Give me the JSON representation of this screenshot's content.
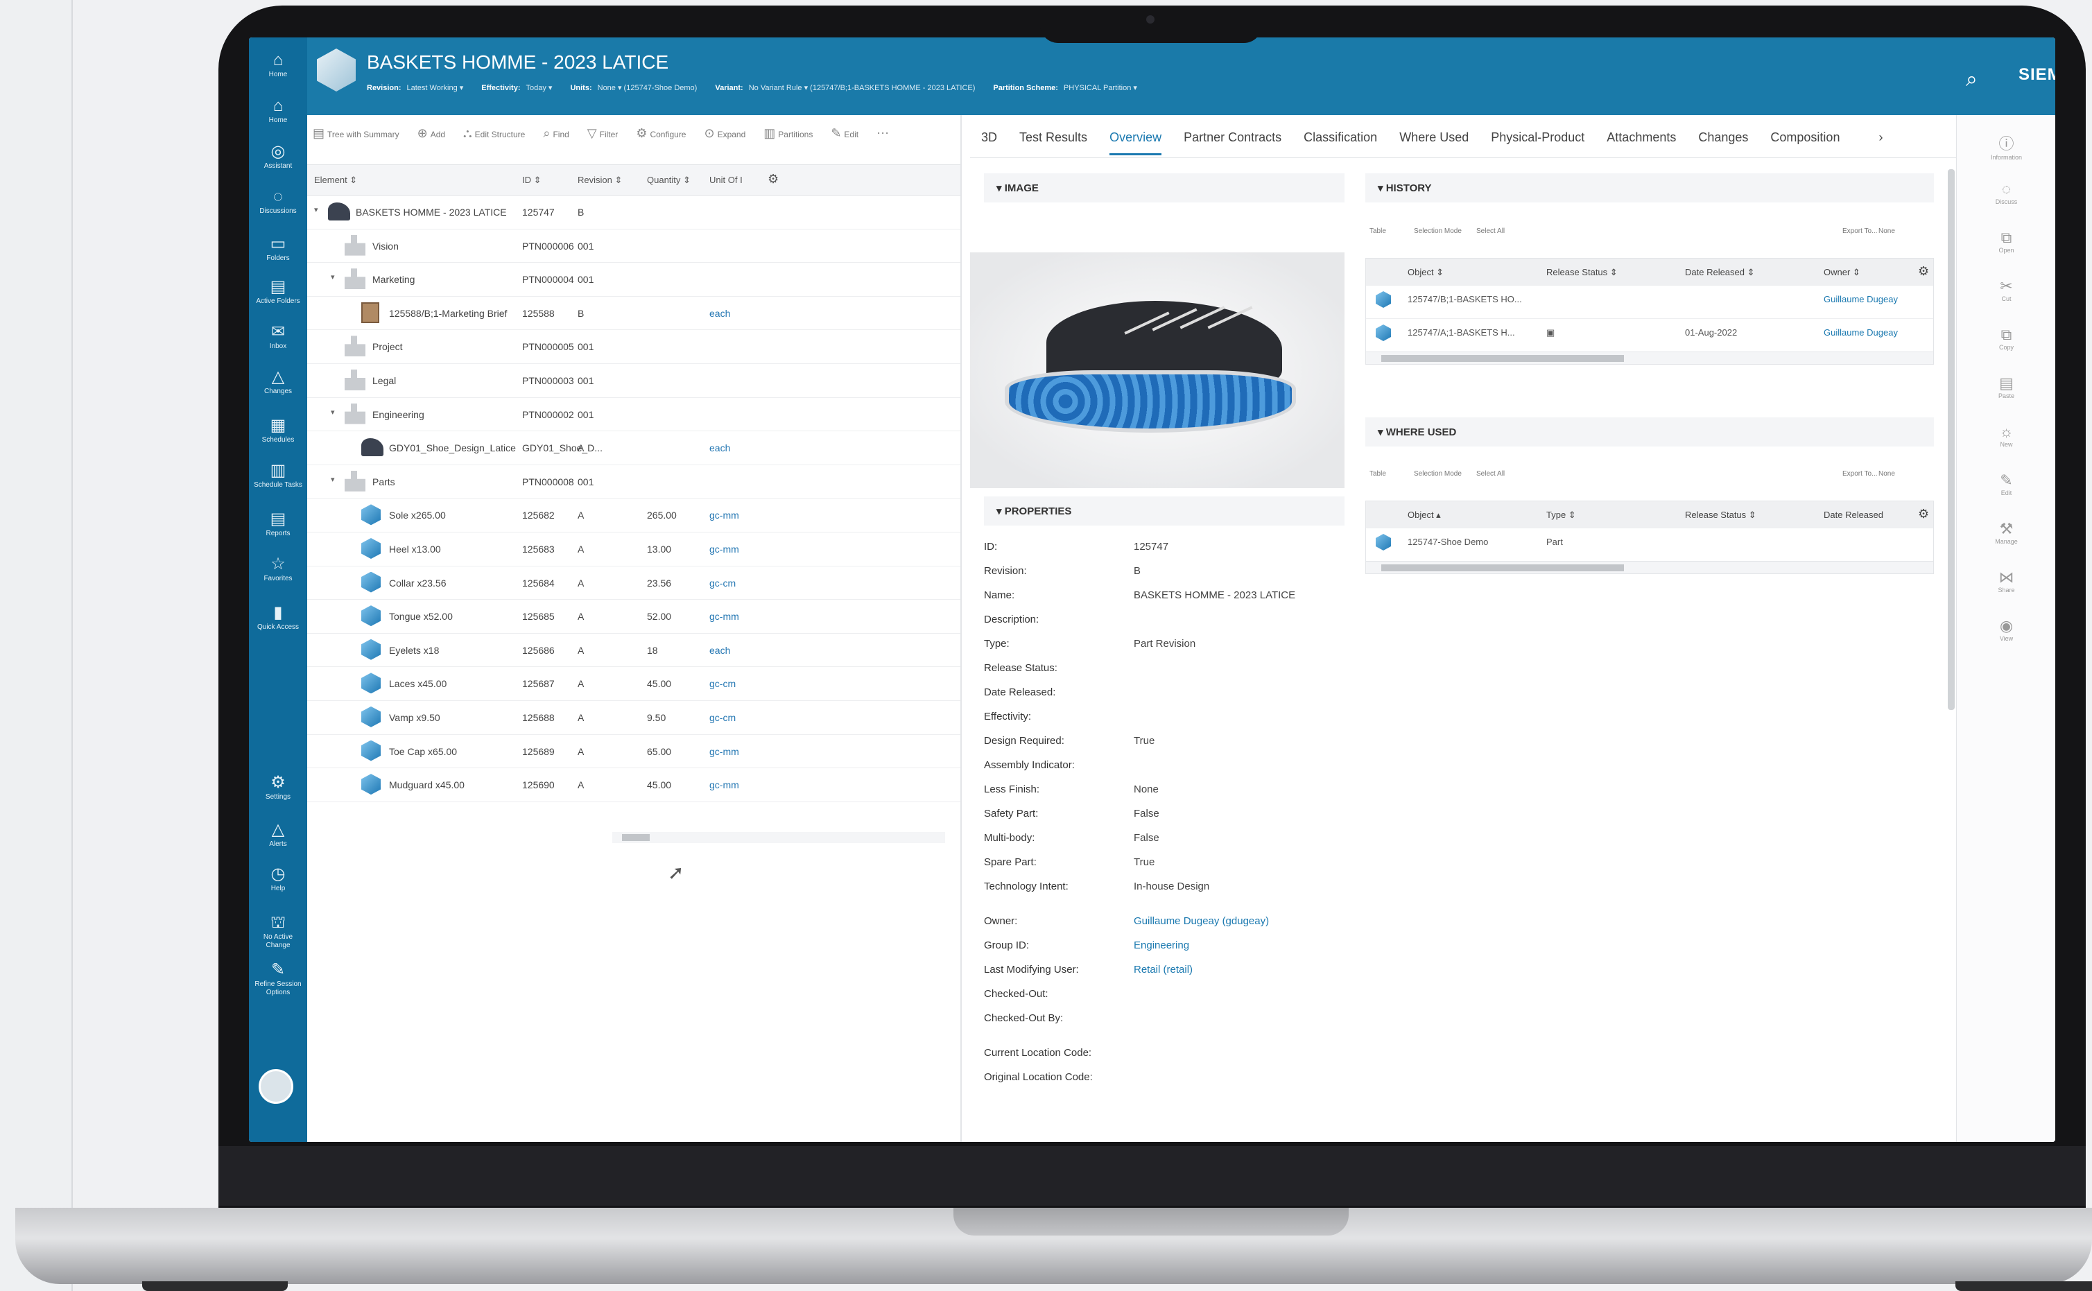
{
  "app": {
    "title": "BASKETS HOMME - 2023 LATICE",
    "brand": "SIEMENS",
    "context": [
      {
        "label": "Revision:",
        "value": "Latest Working ▾"
      },
      {
        "label": "Effectivity:",
        "value": "Today ▾"
      },
      {
        "label": "Units:",
        "value": "None ▾  (125747-Shoe Demo)"
      },
      {
        "label": "Variant:",
        "value": "No Variant Rule ▾  (125747/B;1-BASKETS HOMME - 2023 LATICE)"
      },
      {
        "label": "Partition Scheme:",
        "value": "PHYSICAL Partition ▾"
      }
    ]
  },
  "sidenav": [
    {
      "icon": "⌂",
      "label": "Home"
    },
    {
      "icon": "⌂",
      "label": "Home"
    },
    {
      "icon": "◎",
      "label": "Assistant"
    },
    {
      "icon": "◌",
      "label": "Discussions"
    },
    {
      "icon": "▭",
      "label": "Folders"
    },
    {
      "icon": "▤",
      "label": "Active Folders"
    },
    {
      "icon": "✉",
      "label": "Inbox"
    },
    {
      "icon": "△",
      "label": "Changes"
    },
    {
      "icon": "▦",
      "label": "Schedules"
    },
    {
      "icon": "▥",
      "label": "Schedule Tasks"
    },
    {
      "icon": "▤",
      "label": "Reports"
    },
    {
      "icon": "☆",
      "label": "Favorites"
    },
    {
      "icon": "▮",
      "label": "Quick Access"
    },
    {
      "icon": "⚙",
      "label": "Settings"
    },
    {
      "icon": "△",
      "label": "Alerts"
    },
    {
      "icon": "◷",
      "label": "Help"
    },
    {
      "icon": "⛫",
      "label": "No Active Change"
    },
    {
      "icon": "✎",
      "label": "Refine Session Options"
    }
  ],
  "toolbar": [
    {
      "icon": "▤",
      "label": "Tree with Summary"
    },
    {
      "icon": "⊕",
      "label": "Add"
    },
    {
      "icon": "⛬",
      "label": "Edit Structure"
    },
    {
      "icon": "⌕",
      "label": "Find"
    },
    {
      "icon": "▽",
      "label": "Filter"
    },
    {
      "icon": "⚙",
      "label": "Configure"
    },
    {
      "icon": "⊙",
      "label": "Expand"
    },
    {
      "icon": "▥",
      "label": "Partitions"
    },
    {
      "icon": "✎",
      "label": "Edit"
    },
    {
      "icon": "⋯",
      "label": ""
    }
  ],
  "tree": {
    "headers": {
      "element": "Element ⇕",
      "id": "ID ⇕",
      "revision": "Revision ⇕",
      "quantity": "Quantity ⇕",
      "unit": "Unit Of I"
    },
    "rows": [
      {
        "twisty": "▾",
        "indent": 0,
        "icon": "shoe",
        "element": "BASKETS HOMME - 2023 LATICE",
        "id": "125747",
        "revision": "B",
        "quantity": "",
        "unit": ""
      },
      {
        "twisty": "",
        "indent": 1,
        "icon": "bom",
        "element": "Vision",
        "id": "PTN000006",
        "revision": "001",
        "quantity": "",
        "unit": ""
      },
      {
        "twisty": "▾",
        "indent": 1,
        "icon": "bom",
        "element": "Marketing",
        "id": "PTN000004",
        "revision": "001",
        "quantity": "",
        "unit": ""
      },
      {
        "twisty": "",
        "indent": 2,
        "icon": "doc",
        "element": "125588/B;1-Marketing Brief",
        "id": "125588",
        "revision": "B",
        "quantity": "",
        "unit": "each"
      },
      {
        "twisty": "",
        "indent": 1,
        "icon": "bom",
        "element": "Project",
        "id": "PTN000005",
        "revision": "001",
        "quantity": "",
        "unit": ""
      },
      {
        "twisty": "",
        "indent": 1,
        "icon": "bom",
        "element": "Legal",
        "id": "PTN000003",
        "revision": "001",
        "quantity": "",
        "unit": ""
      },
      {
        "twisty": "▾",
        "indent": 1,
        "icon": "bom",
        "element": "Engineering",
        "id": "PTN000002",
        "revision": "001",
        "quantity": "",
        "unit": ""
      },
      {
        "twisty": "",
        "indent": 2,
        "icon": "shoe",
        "element": "GDY01_Shoe_Design_Latice",
        "id": "GDY01_Shoe_D...",
        "revision": "A",
        "quantity": "",
        "unit": "each"
      },
      {
        "twisty": "▾",
        "indent": 1,
        "icon": "bom",
        "element": "Parts",
        "id": "PTN000008",
        "revision": "001",
        "quantity": "",
        "unit": ""
      },
      {
        "twisty": "",
        "indent": 2,
        "icon": "cube",
        "element": "Sole x265.00",
        "id": "125682",
        "revision": "A",
        "quantity": "265.00",
        "unit": "gc-mm"
      },
      {
        "twisty": "",
        "indent": 2,
        "icon": "cube",
        "element": "Heel x13.00",
        "id": "125683",
        "revision": "A",
        "quantity": "13.00",
        "unit": "gc-mm"
      },
      {
        "twisty": "",
        "indent": 2,
        "icon": "cube",
        "element": "Collar x23.56",
        "id": "125684",
        "revision": "A",
        "quantity": "23.56",
        "unit": "gc-cm"
      },
      {
        "twisty": "",
        "indent": 2,
        "icon": "cube",
        "element": "Tongue x52.00",
        "id": "125685",
        "revision": "A",
        "quantity": "52.00",
        "unit": "gc-mm"
      },
      {
        "twisty": "",
        "indent": 2,
        "icon": "cube",
        "element": "Eyelets x18",
        "id": "125686",
        "revision": "A",
        "quantity": "18",
        "unit": "each"
      },
      {
        "twisty": "",
        "indent": 2,
        "icon": "cube",
        "element": "Laces x45.00",
        "id": "125687",
        "revision": "A",
        "quantity": "45.00",
        "unit": "gc-cm"
      },
      {
        "twisty": "",
        "indent": 2,
        "icon": "cube",
        "element": "Vamp x9.50",
        "id": "125688",
        "revision": "A",
        "quantity": "9.50",
        "unit": "gc-cm"
      },
      {
        "twisty": "",
        "indent": 2,
        "icon": "cube",
        "element": "Toe Cap x65.00",
        "id": "125689",
        "revision": "A",
        "quantity": "65.00",
        "unit": "gc-mm"
      },
      {
        "twisty": "",
        "indent": 2,
        "icon": "cube",
        "element": "Mudguard x45.00",
        "id": "125690",
        "revision": "A",
        "quantity": "45.00",
        "unit": "gc-mm"
      }
    ]
  },
  "tabs": {
    "items": [
      "3D",
      "Test Results",
      "Overview",
      "Partner Contracts",
      "Classification",
      "Where Used",
      "Physical-Product",
      "Attachments",
      "Changes",
      "Composition"
    ],
    "active": "Overview",
    "more": "›"
  },
  "image_section": {
    "title": "IMAGE"
  },
  "properties": {
    "title": "PROPERTIES",
    "items": [
      {
        "label": "ID:",
        "value": "125747",
        "link": false
      },
      {
        "label": "Revision:",
        "value": "B",
        "link": false
      },
      {
        "label": "Name:",
        "value": "BASKETS HOMME - 2023 LATICE",
        "link": false
      },
      {
        "label": "Description:",
        "value": "",
        "link": false
      },
      {
        "label": "Type:",
        "value": "Part Revision",
        "link": false
      },
      {
        "label": "Release Status:",
        "value": "",
        "link": false
      },
      {
        "label": "Date Released:",
        "value": "",
        "link": false
      },
      {
        "label": "Effectivity:",
        "value": "",
        "link": false
      },
      {
        "label": "Design Required:",
        "value": "True",
        "link": false
      },
      {
        "label": "Assembly Indicator:",
        "value": "",
        "link": false
      },
      {
        "label": "Less Finish:",
        "value": "None",
        "link": false
      },
      {
        "label": "Safety Part:",
        "value": "False",
        "link": false
      },
      {
        "label": "Multi-body:",
        "value": "False",
        "link": false
      },
      {
        "label": "Spare Part:",
        "value": "True",
        "link": false
      },
      {
        "label": "Technology Intent:",
        "value": "In-house Design",
        "link": false
      },
      {
        "label": "Owner:",
        "value": "Guillaume Dugeay (gdugeay)",
        "link": true
      },
      {
        "label": "Group ID:",
        "value": "Engineering",
        "link": true
      },
      {
        "label": "Last Modifying User:",
        "value": "Retail (retail)",
        "link": true
      },
      {
        "label": "Checked-Out:",
        "value": "",
        "link": false
      },
      {
        "label": "Checked-Out By:",
        "value": "",
        "link": false
      },
      {
        "label": "Current Location Code:",
        "value": "",
        "link": false
      },
      {
        "label": "Original Location Code:",
        "value": "",
        "link": false
      }
    ]
  },
  "history": {
    "title": "HISTORY",
    "tools": [
      "Table",
      "Selection Mode",
      "Select All",
      "Export To...",
      "None"
    ],
    "headers": [
      "Object ⇕",
      "Release Status ⇕",
      "Date Released ⇕",
      "Owner ⇕"
    ],
    "rows": [
      {
        "object": "125747/B;1-BASKETS HO...",
        "status": "",
        "date": "",
        "owner": "Guillaume Dugeay"
      },
      {
        "object": "125747/A;1-BASKETS H...",
        "status": "▣",
        "date": "01-Aug-2022",
        "owner": "Guillaume Dugeay"
      }
    ]
  },
  "where_used": {
    "title": "WHERE USED",
    "tools": [
      "Table",
      "Selection Mode",
      "Select All",
      "Export To...",
      "None"
    ],
    "headers": [
      "Object ▴",
      "Type ⇕",
      "Release Status ⇕",
      "Date Released"
    ],
    "rows": [
      {
        "object": "125747-Shoe Demo",
        "type": "Part",
        "status": "",
        "date": ""
      }
    ]
  },
  "right_rail": [
    {
      "icon": "ⓘ",
      "label": "Information"
    },
    {
      "icon": "◌",
      "label": "Discuss"
    },
    {
      "icon": "⧉",
      "label": "Open"
    },
    {
      "icon": "✂",
      "label": "Cut"
    },
    {
      "icon": "⧉",
      "label": "Copy"
    },
    {
      "icon": "▤",
      "label": "Paste"
    },
    {
      "icon": "☼",
      "label": "New"
    },
    {
      "icon": "✎",
      "label": "Edit"
    },
    {
      "icon": "⚒",
      "label": "Manage"
    },
    {
      "icon": "⋈",
      "label": "Share"
    },
    {
      "icon": "◉",
      "label": "View"
    }
  ],
  "colors": {
    "nav": "#0f6b9b",
    "topbar": "#1a7aa9",
    "accent": "#1b79b0"
  }
}
